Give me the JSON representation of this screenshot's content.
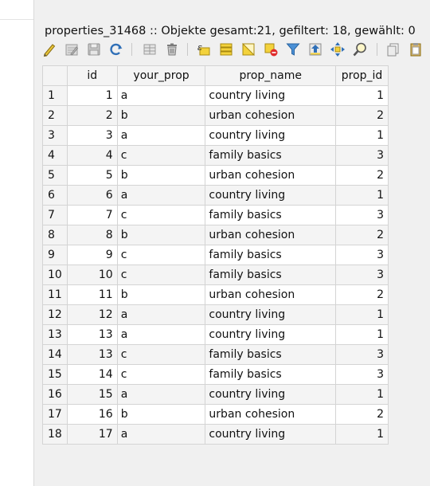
{
  "window": {
    "title": "properties_31468 :: Objekte gesamt:21, gefiltert: 18, gewählt: 0"
  },
  "toolbar": {
    "buttons": [
      {
        "name": "toggle-editing-icon"
      },
      {
        "name": "multi-edit-icon"
      },
      {
        "name": "save-edits-icon"
      },
      {
        "name": "reload-icon"
      },
      {
        "name": "add-feature-icon"
      },
      {
        "name": "delete-selected-icon"
      },
      {
        "name": "select-by-expression-icon"
      },
      {
        "name": "select-all-icon"
      },
      {
        "name": "invert-selection-icon"
      },
      {
        "name": "deselect-all-icon"
      },
      {
        "name": "filter-icon"
      },
      {
        "name": "move-selection-to-top-icon"
      },
      {
        "name": "pan-map-to-selection-icon"
      },
      {
        "name": "zoom-to-selection-icon"
      },
      {
        "name": "copy-rows-icon"
      },
      {
        "name": "paste-icon"
      }
    ]
  },
  "table": {
    "columns": [
      "id",
      "your_prop",
      "prop_name",
      "prop_id"
    ],
    "rows": [
      {
        "n": "1",
        "id": "1",
        "your_prop": "a",
        "prop_name": "country living",
        "prop_id": "1"
      },
      {
        "n": "2",
        "id": "2",
        "your_prop": "b",
        "prop_name": "urban cohesion",
        "prop_id": "2"
      },
      {
        "n": "3",
        "id": "3",
        "your_prop": "a",
        "prop_name": "country living",
        "prop_id": "1"
      },
      {
        "n": "4",
        "id": "4",
        "your_prop": "c",
        "prop_name": "family basics",
        "prop_id": "3"
      },
      {
        "n": "5",
        "id": "5",
        "your_prop": "b",
        "prop_name": "urban cohesion",
        "prop_id": "2"
      },
      {
        "n": "6",
        "id": "6",
        "your_prop": "a",
        "prop_name": "country living",
        "prop_id": "1"
      },
      {
        "n": "7",
        "id": "7",
        "your_prop": "c",
        "prop_name": "family basics",
        "prop_id": "3"
      },
      {
        "n": "8",
        "id": "8",
        "your_prop": "b",
        "prop_name": "urban cohesion",
        "prop_id": "2"
      },
      {
        "n": "9",
        "id": "9",
        "your_prop": "c",
        "prop_name": "family basics",
        "prop_id": "3"
      },
      {
        "n": "10",
        "id": "10",
        "your_prop": "c",
        "prop_name": "family basics",
        "prop_id": "3"
      },
      {
        "n": "11",
        "id": "11",
        "your_prop": "b",
        "prop_name": "urban cohesion",
        "prop_id": "2"
      },
      {
        "n": "12",
        "id": "12",
        "your_prop": "a",
        "prop_name": "country living",
        "prop_id": "1"
      },
      {
        "n": "13",
        "id": "13",
        "your_prop": "a",
        "prop_name": "country living",
        "prop_id": "1"
      },
      {
        "n": "14",
        "id": "13",
        "your_prop": "c",
        "prop_name": "family basics",
        "prop_id": "3"
      },
      {
        "n": "15",
        "id": "14",
        "your_prop": "c",
        "prop_name": "family basics",
        "prop_id": "3"
      },
      {
        "n": "16",
        "id": "15",
        "your_prop": "a",
        "prop_name": "country living",
        "prop_id": "1"
      },
      {
        "n": "17",
        "id": "16",
        "your_prop": "b",
        "prop_name": "urban cohesion",
        "prop_id": "2"
      },
      {
        "n": "18",
        "id": "17",
        "your_prop": "a",
        "prop_name": "country living",
        "prop_id": "1"
      }
    ]
  }
}
